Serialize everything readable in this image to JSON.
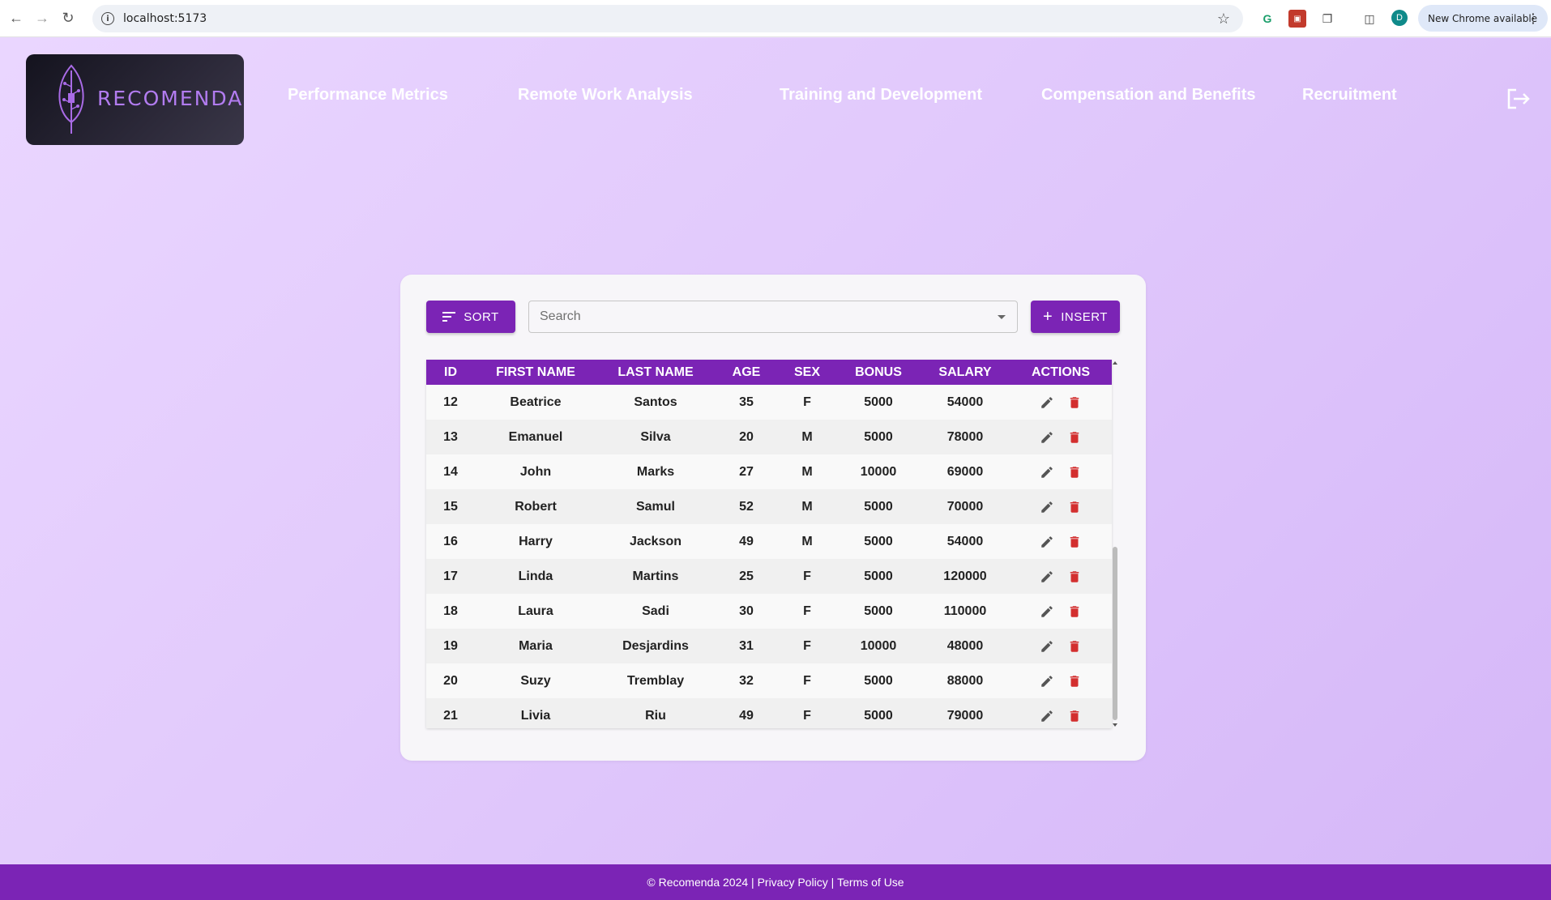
{
  "browser": {
    "url": "localhost:5173",
    "new_chrome_label": "New Chrome available",
    "profile_initial": "D"
  },
  "brand": {
    "name": "RECOMENDA",
    "logo_color": "#b27cf0"
  },
  "nav": {
    "items": [
      {
        "label": "Performance Metrics"
      },
      {
        "label": "Remote Work Analysis"
      },
      {
        "label": "Training and Development"
      },
      {
        "label": "Compensation and Benefits"
      },
      {
        "label": "Recruitment"
      }
    ]
  },
  "toolbar": {
    "sort_label": "SORT",
    "search_placeholder": "Search",
    "insert_label": "INSERT"
  },
  "table": {
    "columns": [
      "ID",
      "FIRST NAME",
      "LAST NAME",
      "AGE",
      "SEX",
      "BONUS",
      "SALARY",
      "ACTIONS"
    ],
    "rows": [
      {
        "id": "12",
        "first": "Beatrice",
        "last": "Santos",
        "age": "35",
        "sex": "F",
        "bonus": "5000",
        "salary": "54000"
      },
      {
        "id": "13",
        "first": "Emanuel",
        "last": "Silva",
        "age": "20",
        "sex": "M",
        "bonus": "5000",
        "salary": "78000"
      },
      {
        "id": "14",
        "first": "John",
        "last": "Marks",
        "age": "27",
        "sex": "M",
        "bonus": "10000",
        "salary": "69000"
      },
      {
        "id": "15",
        "first": "Robert",
        "last": "Samul",
        "age": "52",
        "sex": "M",
        "bonus": "5000",
        "salary": "70000"
      },
      {
        "id": "16",
        "first": "Harry",
        "last": "Jackson",
        "age": "49",
        "sex": "M",
        "bonus": "5000",
        "salary": "54000"
      },
      {
        "id": "17",
        "first": "Linda",
        "last": "Martins",
        "age": "25",
        "sex": "F",
        "bonus": "5000",
        "salary": "120000"
      },
      {
        "id": "18",
        "first": "Laura",
        "last": "Sadi",
        "age": "30",
        "sex": "F",
        "bonus": "5000",
        "salary": "110000"
      },
      {
        "id": "19",
        "first": "Maria",
        "last": "Desjardins",
        "age": "31",
        "sex": "F",
        "bonus": "10000",
        "salary": "48000"
      },
      {
        "id": "20",
        "first": "Suzy",
        "last": "Tremblay",
        "age": "32",
        "sex": "F",
        "bonus": "5000",
        "salary": "88000"
      },
      {
        "id": "21",
        "first": "Livia",
        "last": "Riu",
        "age": "49",
        "sex": "F",
        "bonus": "5000",
        "salary": "79000"
      }
    ]
  },
  "footer": {
    "copyright": "© Recomenda 2024",
    "sep": " | ",
    "privacy": "Privacy Policy",
    "terms": "Terms of Use"
  },
  "colors": {
    "accent": "#7b24b5",
    "delete": "#d32f2f",
    "edit": "#555555"
  }
}
